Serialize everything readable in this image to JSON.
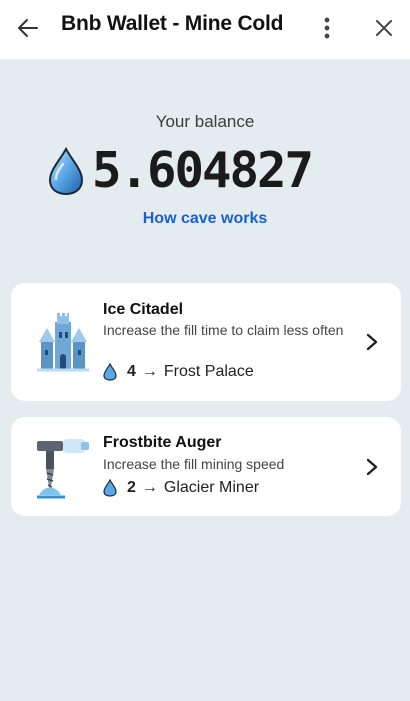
{
  "header": {
    "title": "Bnb Wallet - Mine Cold",
    "back_icon": "arrow-left-icon",
    "more_icon": "more-vertical-icon",
    "close_icon": "close-icon"
  },
  "balance": {
    "label": "Your balance",
    "value": "5.604827",
    "icon": "water-drop-icon",
    "link": "How cave works"
  },
  "upgrades": [
    {
      "title": "Ice Citadel",
      "description": "Increase the fill time to claim less often",
      "cost": "4",
      "target": "Frost Palace",
      "arrow": "→",
      "image": "ice-castle-image"
    },
    {
      "title": "Frostbite Auger",
      "description": "Increase the fill mining speed",
      "cost": "2",
      "target": "Glacier Miner",
      "arrow": "→",
      "image": "ice-drill-image"
    }
  ],
  "colors": {
    "background": "#e5ecf0",
    "link": "#1a5fd6",
    "drop": "#5aa7e6"
  }
}
